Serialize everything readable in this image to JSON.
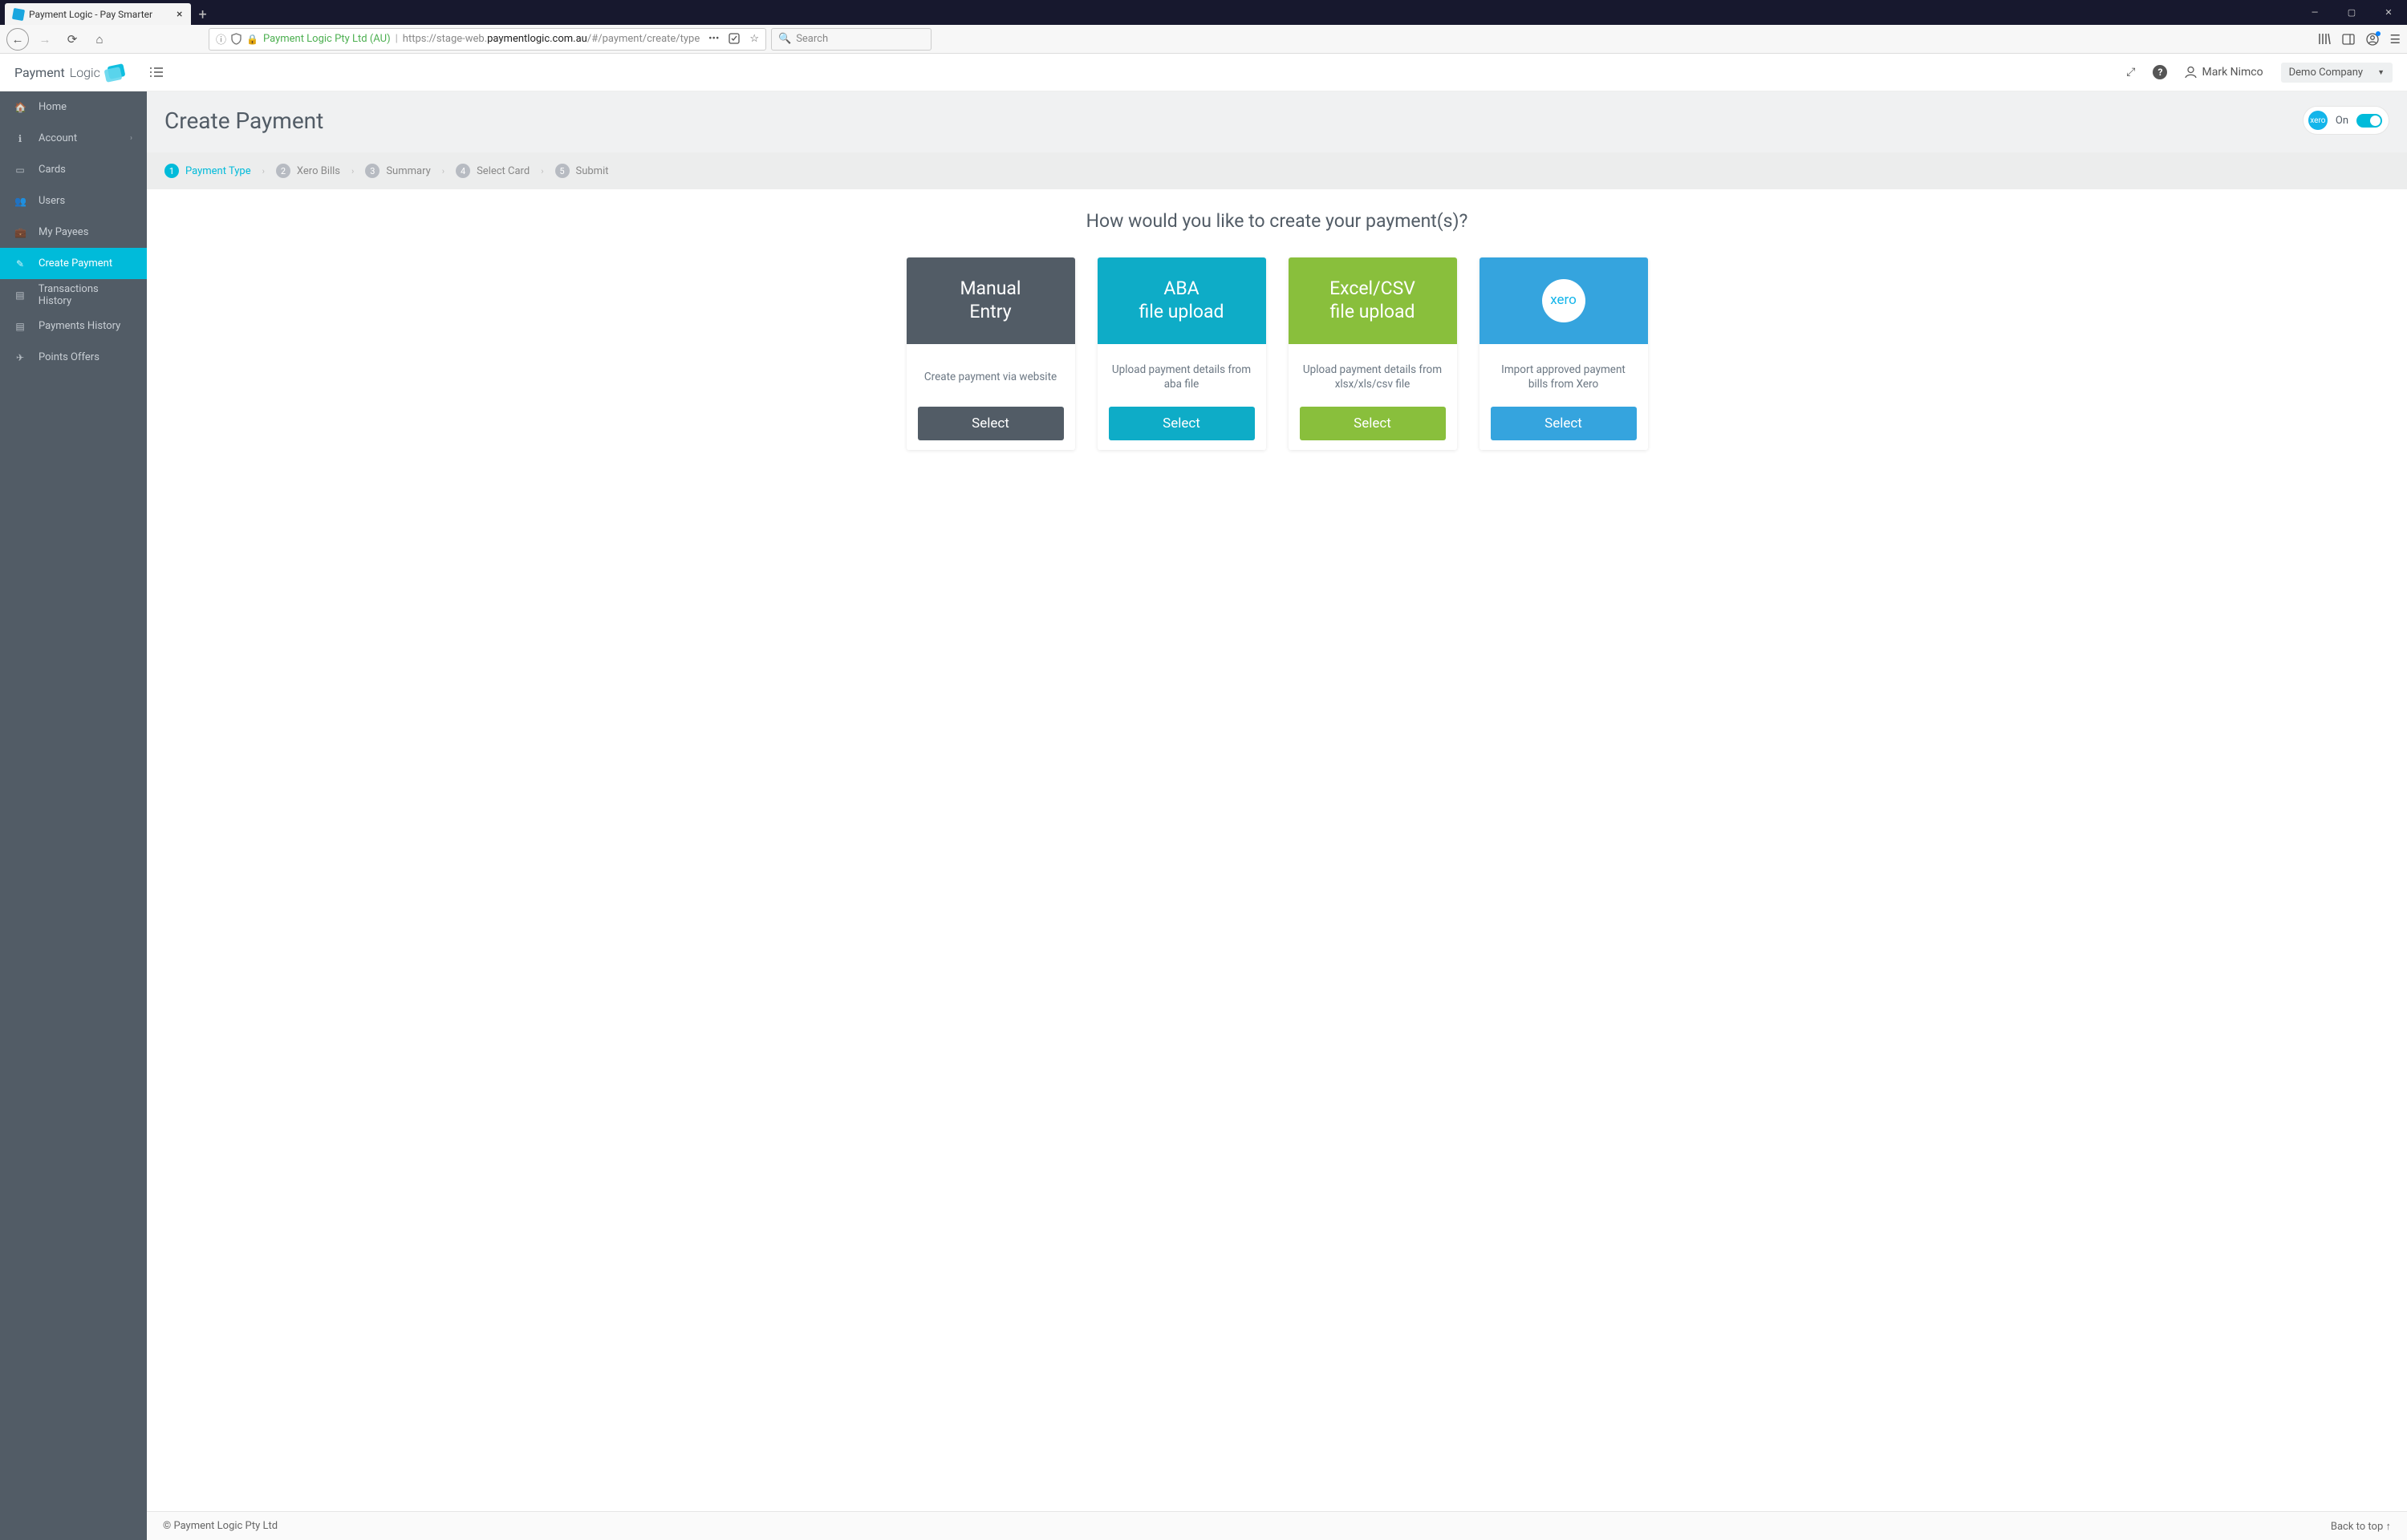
{
  "browser": {
    "tab_title": "Payment Logic - Pay Smarter",
    "url_org": "Payment Logic Pty Ltd (AU)",
    "url_prefix": "https://stage-web.",
    "url_domain": "paymentlogic.com.au",
    "url_path": "/#/payment/create/type",
    "search_placeholder": "Search"
  },
  "header": {
    "brand1": "Payment",
    "brand2": "Logic",
    "user_name": "Mark Nimco",
    "company": "Demo Company"
  },
  "sidebar": {
    "items": [
      {
        "label": "Home",
        "icon": "home-icon"
      },
      {
        "label": "Account",
        "icon": "user-icon",
        "chevron": true
      },
      {
        "label": "Cards",
        "icon": "card-icon"
      },
      {
        "label": "Users",
        "icon": "users-icon"
      },
      {
        "label": "My Payees",
        "icon": "briefcase-icon"
      },
      {
        "label": "Create Payment",
        "icon": "edit-icon",
        "active": true
      },
      {
        "label": "Transactions History",
        "icon": "list-icon"
      },
      {
        "label": "Payments History",
        "icon": "list-icon"
      },
      {
        "label": "Points Offers",
        "icon": "plane-icon"
      }
    ]
  },
  "page": {
    "title": "Create Payment",
    "xero_toggle_label": "On",
    "question": "How would you like to create your payment(s)?",
    "footer_copy": "© Payment Logic Pty Ltd",
    "back_to_top": "Back to top"
  },
  "wizard": {
    "steps": [
      {
        "num": "1",
        "label": "Payment Type"
      },
      {
        "num": "2",
        "label": "Xero Bills"
      },
      {
        "num": "3",
        "label": "Summary"
      },
      {
        "num": "4",
        "label": "Select Card"
      },
      {
        "num": "5",
        "label": "Submit"
      }
    ]
  },
  "cards": [
    {
      "title_l1": "Manual",
      "title_l2": "Entry",
      "desc": "Create payment via website",
      "btn": "Select"
    },
    {
      "title_l1": "ABA",
      "title_l2": "file upload",
      "desc": "Upload payment details from aba file",
      "btn": "Select"
    },
    {
      "title_l1": "Excel/CSV",
      "title_l2": "file upload",
      "desc": "Upload payment details from xlsx/xls/csv file",
      "btn": "Select"
    },
    {
      "title_l1": "xero",
      "title_l2": "",
      "desc": "Import approved payment bills from Xero",
      "btn": "Select",
      "is_xero": true
    }
  ]
}
